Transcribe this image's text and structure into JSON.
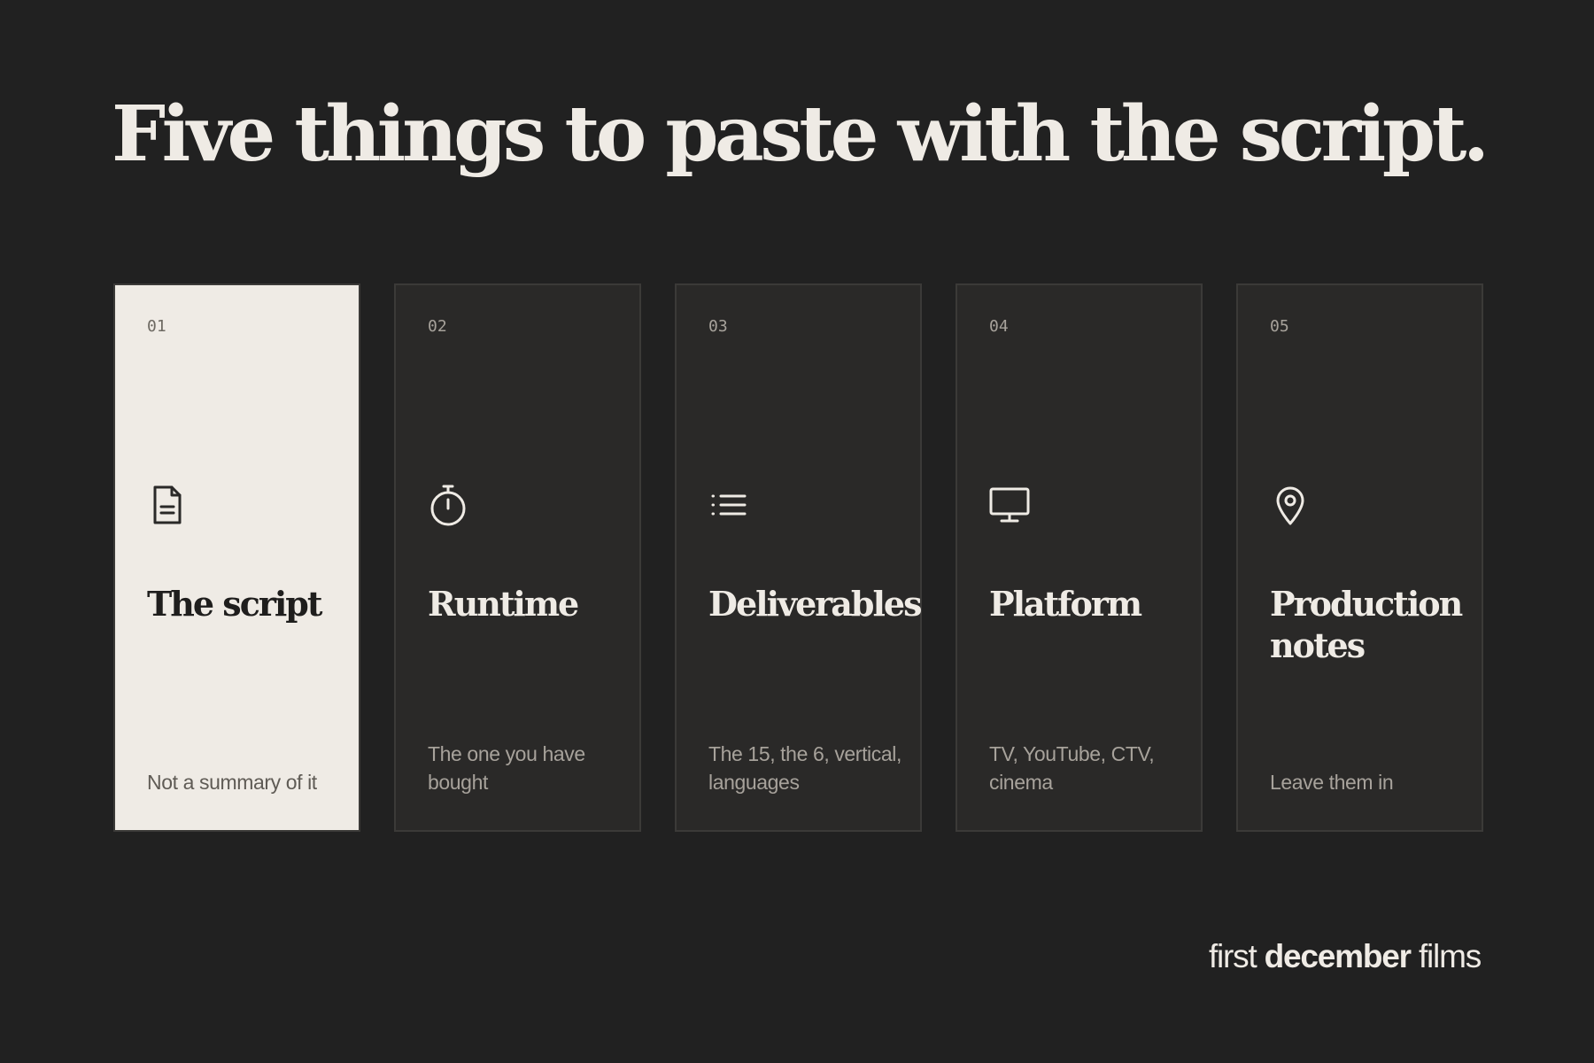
{
  "headline": "Five things to paste with the script.",
  "cards": [
    {
      "number": "01",
      "icon": "document-icon",
      "title": "The script",
      "caption": "Not a summary of it",
      "active": true
    },
    {
      "number": "02",
      "icon": "stopwatch-icon",
      "title": "Runtime",
      "caption": "The one you have bought",
      "active": false
    },
    {
      "number": "03",
      "icon": "list-icon",
      "title": "Deliverables",
      "caption": "The 15, the 6, vertical, languages",
      "active": false
    },
    {
      "number": "04",
      "icon": "monitor-icon",
      "title": "Platform",
      "caption": "TV, YouTube, CTV, cinema",
      "active": false
    },
    {
      "number": "05",
      "icon": "location-pin-icon",
      "title": "Production notes",
      "caption": "Leave them in",
      "active": false
    }
  ],
  "brand": {
    "first": "first",
    "middle": "december",
    "last": "films"
  },
  "colors": {
    "background": "#212121",
    "card": "#2a2928",
    "card_active": "#efebe5",
    "text_light": "#efebe5",
    "text_muted": "#a7a29b"
  }
}
